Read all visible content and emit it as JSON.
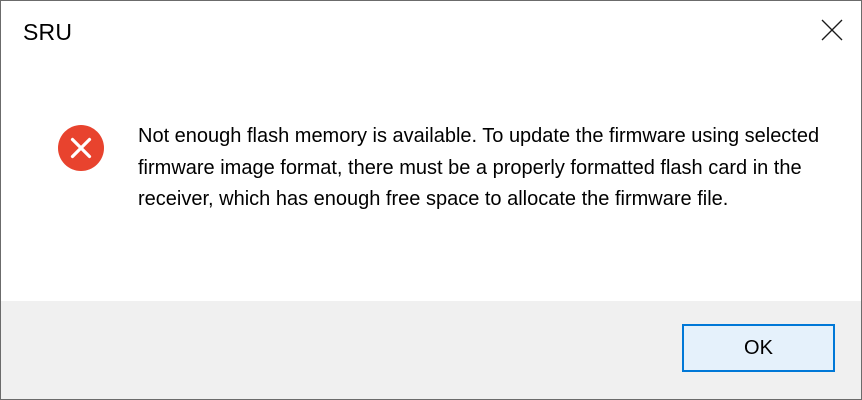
{
  "window": {
    "title": "SRU",
    "close_icon": "close-icon"
  },
  "dialog": {
    "icon": "error-icon",
    "icon_color": "#e8432e",
    "message": "Not enough flash memory is available. To update the firmware using selected firmware image format, there must be a properly formatted flash card in the receiver, which has enough free space to allocate the firmware file."
  },
  "buttons": {
    "ok_label": "OK",
    "accent": "#0078d7"
  }
}
